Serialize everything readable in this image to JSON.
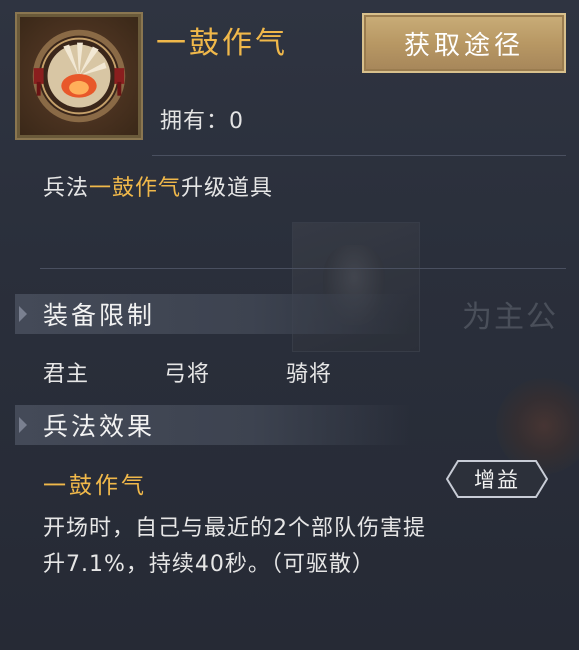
{
  "item": {
    "name": "一鼓作气",
    "owned_label": "拥有：",
    "owned_count": "0",
    "acquire_button": "获取途径",
    "icon": "drum-spirit-icon"
  },
  "description": {
    "prefix": "兵法",
    "highlight": "一鼓作气",
    "suffix": "升级道具"
  },
  "equip_restriction": {
    "title": "装备限制",
    "items": [
      "君主",
      "弓将",
      "骑将"
    ]
  },
  "effect": {
    "title": "兵法效果",
    "name": "一鼓作气",
    "badge": "增益",
    "text_line1": "开场时，自己与最近的2个部队伤害提",
    "text_line2": "升7.1%，持续40秒。（可驱散）"
  },
  "background": {
    "ghost_text": "为主公"
  },
  "colors": {
    "accent_gold": "#f0b84a",
    "button_gold": "#b89864",
    "panel_bg": "#2a2f3b"
  }
}
